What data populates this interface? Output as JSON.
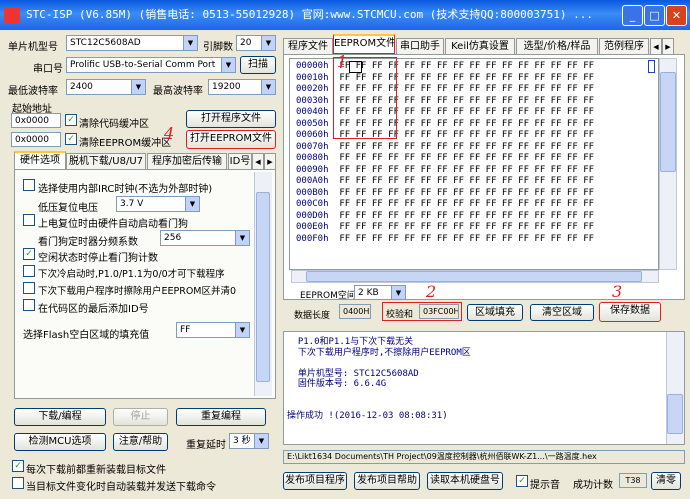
{
  "title": "STC-ISP (V6.85M) (销售电话: 0513-55012928) 官网:www.STCMCU.com (技术支持QQ:800003751) ...",
  "left": {
    "mcu_type_label": "单片机型号",
    "mcu_type": "STC12C5608AD",
    "pins_label": "引脚数",
    "pins": "20",
    "port_label": "串口号",
    "port": "Prolific USB-to-Serial Comm Port",
    "scan": "扫描",
    "min_baud_label": "最低波特率",
    "min_baud": "2400",
    "max_baud_label": "最高波特率",
    "max_baud": "19200",
    "start_addr_label": "起始地址",
    "addr1": "0x0000",
    "clear_code": "清除代码缓冲区",
    "open_prog": "打开程序文件",
    "addr2": "0x0000",
    "clear_eeprom": "清除EEPROM缓冲区",
    "open_eeprom": "打开EEPROM文件",
    "tabs": [
      "硬件选项",
      "脱机下载/U8/U7",
      "程序加密后传输",
      "ID号"
    ],
    "opt_irc": "选择使用内部IRC时钟(不选为外部时钟)",
    "opt_lowvolt_label": "低压复位电压",
    "opt_lowvolt": "3.7 V",
    "opt_watchdog": "上电复位时由硬件自动启动看门狗",
    "opt_wdt_div_label": "看门狗定时器分频系数",
    "opt_wdt_div": "256",
    "opt_idle": "空闲状态时停止看门狗计数",
    "opt_p10": "下次冷启动时,P1.0/P1.1为0/0才可下载程序",
    "opt_eeprom": "下次下载用户程序时擦除用户EEPROM区并清0",
    "opt_id": "在代码区的最后添加ID号",
    "opt_fill_label": "选择Flash空白区域的填充值",
    "opt_fill": "FF",
    "download": "下载/编程",
    "stop": "停止",
    "redownload": "重复编程",
    "detect": "检测MCU选项",
    "help": "注意/帮助",
    "delay_label": "重复延时",
    "delay": "3 秒",
    "reload": "每次下载前都重新装载目标文件",
    "autosend": "当目标文件变化时自动装载并发送下载命令"
  },
  "right": {
    "tabs": [
      "程序文件",
      "EEPROM文件",
      "串口助手",
      "Keil仿真设置",
      "选型/价格/样品",
      "范例程序"
    ],
    "hex_rows": [
      {
        "addr": "00000h",
        "bytes": "FF FF FF FF FF FF FF FF FF FF FF FF FF FF FF FF"
      },
      {
        "addr": "00010h",
        "bytes": "FF FF FF FF FF FF FF FF FF FF FF FF FF FF FF FF"
      },
      {
        "addr": "00020h",
        "bytes": "FF FF FF FF FF FF FF FF FF FF FF FF FF FF FF FF"
      },
      {
        "addr": "00030h",
        "bytes": "FF FF FF FF FF FF FF FF FF FF FF FF FF FF FF FF"
      },
      {
        "addr": "00040h",
        "bytes": "FF FF FF FF FF FF FF FF FF FF FF FF FF FF FF FF"
      },
      {
        "addr": "00050h",
        "bytes": "FF FF FF FF FF FF FF FF FF FF FF FF FF FF FF FF"
      },
      {
        "addr": "00060h",
        "bytes": "FF FF FF FF FF FF FF FF FF FF FF FF FF FF FF FF"
      },
      {
        "addr": "00070h",
        "bytes": "FF FF FF FF FF FF FF FF FF FF FF FF FF FF FF FF"
      },
      {
        "addr": "00080h",
        "bytes": "FF FF FF FF FF FF FF FF FF FF FF FF FF FF FF FF"
      },
      {
        "addr": "00090h",
        "bytes": "FF FF FF FF FF FF FF FF FF FF FF FF FF FF FF FF"
      },
      {
        "addr": "000A0h",
        "bytes": "FF FF FF FF FF FF FF FF FF FF FF FF FF FF FF FF"
      },
      {
        "addr": "000B0h",
        "bytes": "FF FF FF FF FF FF FF FF FF FF FF FF FF FF FF FF"
      },
      {
        "addr": "000C0h",
        "bytes": "FF FF FF FF FF FF FF FF FF FF FF FF FF FF FF FF"
      },
      {
        "addr": "000D0h",
        "bytes": "FF FF FF FF FF FF FF FF FF FF FF FF FF FF FF FF"
      },
      {
        "addr": "000E0h",
        "bytes": "FF FF FF FF FF FF FF FF FF FF FF FF FF FF FF FF"
      },
      {
        "addr": "000F0h",
        "bytes": "FF FF FF FF FF FF FF FF FF FF FF FF FF FF FF FF"
      }
    ],
    "eeprom_space_label": "EEPROM空间",
    "eeprom_space": "2 KB",
    "length_label": "数据长度",
    "length": "0400H",
    "checksum_label": "校验和",
    "checksum": "03FC00H",
    "fill_area": "区域填充",
    "clear_area": "清空区域",
    "save": "保存数据",
    "log_lines": [
      "  P1.0和P1.1与下次下载无关",
      "  下次下载用户程序时,不擦除用户EEPROM区",
      "",
      "  单片机型号: STC12C5608AD",
      "  固件版本号: 6.6.4G",
      "",
      "",
      "操作成功 !(2016-12-03 08:08:31)"
    ],
    "path": "E:\\Likt1634 Documents\\TH Project\\09温度控制器\\杭州佰联WK-Z1...\\一路温度.hex",
    "publish_prog": "发布项目程序",
    "publish_help": "发布项目帮助",
    "read_disk": "读取本机硬盘号",
    "prompt": "提示音",
    "success_label": "成功计数",
    "success": "T38",
    "clear": "清零"
  },
  "annotations": [
    "1",
    "2",
    "3",
    "4"
  ],
  "checks": {
    "clear_code": "✓",
    "clear_eeprom": "✓",
    "idle": "✓",
    "reload": "✓",
    "prompt": "✓"
  }
}
